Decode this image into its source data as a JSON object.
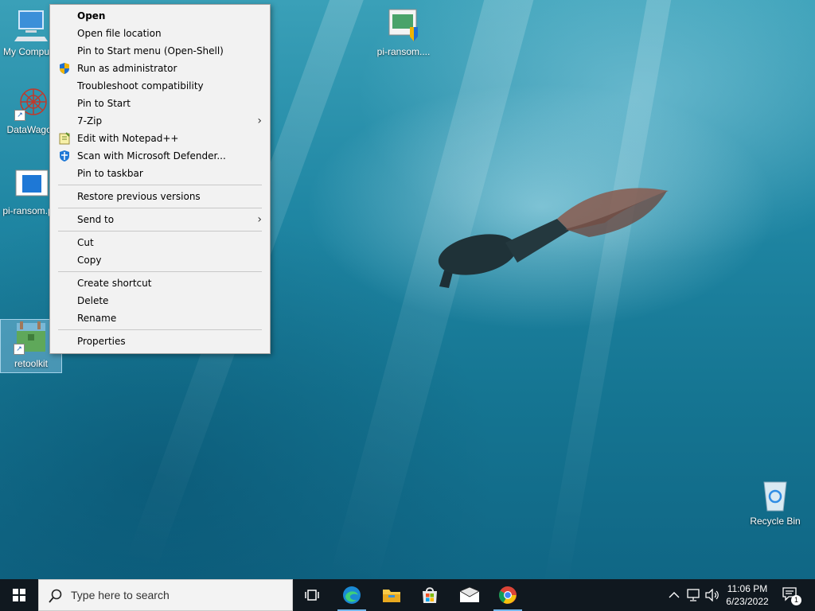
{
  "desktop": {
    "icons": [
      {
        "label": "My Computer"
      },
      {
        "label": "DataWagon"
      },
      {
        "label": "pi-ransom.pdf"
      },
      {
        "label": "retoolkit"
      },
      {
        "label": "pi-ransom...."
      },
      {
        "label": "Recycle Bin"
      }
    ]
  },
  "context_menu": {
    "items": [
      {
        "label": "Open"
      },
      {
        "label": "Open file location"
      },
      {
        "label": "Pin to Start menu (Open-Shell)"
      },
      {
        "label": "Run as administrator"
      },
      {
        "label": "Troubleshoot compatibility"
      },
      {
        "label": "Pin to Start"
      },
      {
        "label": "7-Zip"
      },
      {
        "label": "Edit with Notepad++"
      },
      {
        "label": "Scan with Microsoft Defender..."
      },
      {
        "label": "Pin to taskbar"
      },
      {
        "label": "Restore previous versions"
      },
      {
        "label": "Send to"
      },
      {
        "label": "Cut"
      },
      {
        "label": "Copy"
      },
      {
        "label": "Create shortcut"
      },
      {
        "label": "Delete"
      },
      {
        "label": "Rename"
      },
      {
        "label": "Properties"
      }
    ]
  },
  "taskbar": {
    "search_placeholder": "Type here to search",
    "apps": [
      "task-view-icon",
      "edge-icon",
      "file-explorer-icon",
      "store-icon",
      "mail-icon",
      "chrome-icon"
    ],
    "time": "11:06 PM",
    "date": "6/23/2022",
    "notification_count": "1"
  },
  "colors": {
    "taskbar": "#10181f",
    "menu_bg": "#f2f2f2",
    "accent": "#76b9ed"
  }
}
